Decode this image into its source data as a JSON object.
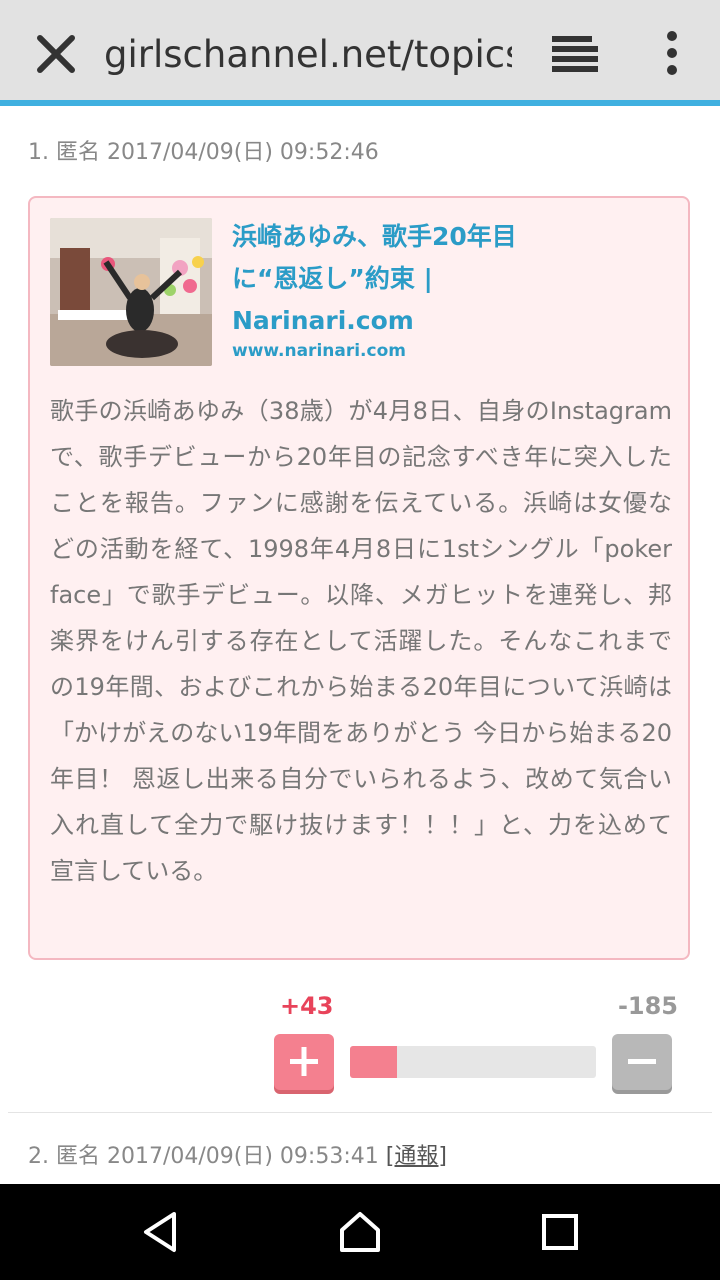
{
  "browser": {
    "url": "girlschannel.net/topics",
    "icons": [
      "close-icon",
      "tabs-icon",
      "overflow-menu-icon"
    ]
  },
  "comment1": {
    "meta": "1. 匿名 2017/04/09(日) 09:52:46",
    "link_title_line1": "浜崎あゆみ、歌手20年目",
    "link_title_line2": "に“恩返し”約束 |",
    "link_title_line3": "Narinari.com",
    "link_domain": "www.narinari.com",
    "body": "歌手の浜崎あゆみ（38歳）が4月8日、自身のInstagramで、歌手デビューから20年目の記念すべき年に突入したことを報告。ファンに感謝を伝えている。浜崎は女優などの活動を経て、1998年4月8日に1stシングル「poker face」で歌手デビュー。以降、メガヒットを連発し、邦楽界をけん引する存在として活躍した。そんなこれまでの19年間、およびこれから始まる20年目について浜崎は「かけがえのない19年間をありがとう 今日から始まる20年目！ 恩返し出来る自分でいられるよう、改めて気合い入れ直して全力で駆け抜けます！！！」と、力を込めて宣言している。",
    "plus": "+43",
    "minus": "-185",
    "plus_ratio": 0.19
  },
  "comment2": {
    "meta": "2. 匿名 2017/04/09(日) 09:53:41 ",
    "report": "[通報]"
  },
  "nav": {
    "icons": [
      "back-icon",
      "home-icon",
      "recents-icon"
    ]
  },
  "colors": {
    "accent": "#2b9cc7",
    "plus": "#e8435a",
    "card_bg": "#fff0f1",
    "card_border": "#f4b8c1"
  }
}
